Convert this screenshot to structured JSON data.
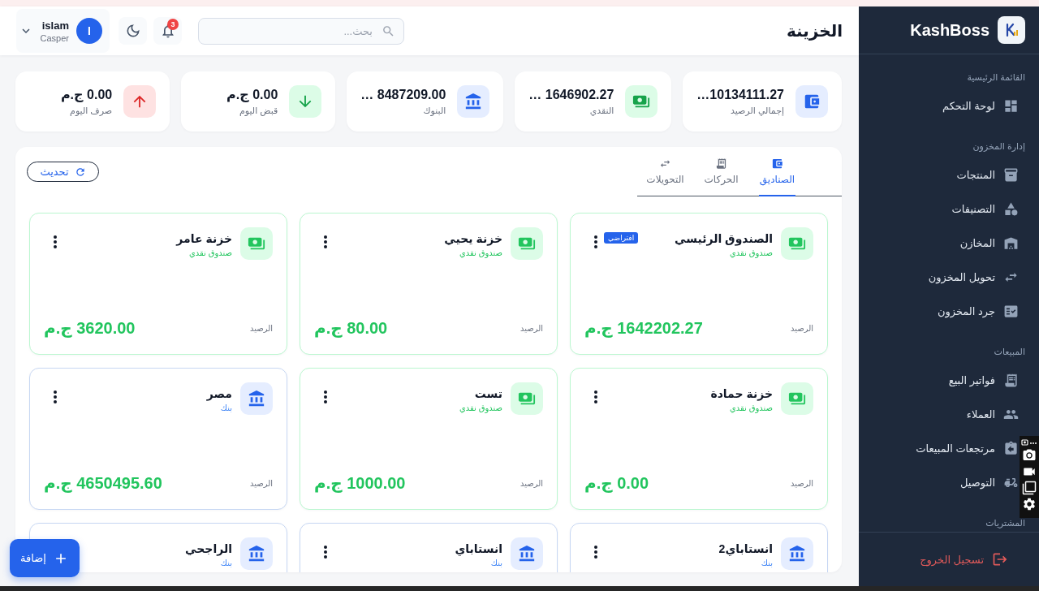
{
  "sidebar": {
    "brand": "KashBoss",
    "sections": [
      {
        "title": "القائمة الرئيسية",
        "items": [
          {
            "label": "لوحة التحكم",
            "selected": false
          }
        ]
      },
      {
        "title": "إدارة المخزون",
        "items": [
          {
            "label": "المنتجات",
            "selected": false
          },
          {
            "label": "التصنيفات",
            "selected": false
          },
          {
            "label": "المخازن",
            "selected": false
          },
          {
            "label": "تحويل المخزون",
            "selected": false
          },
          {
            "label": "جرد المخزون",
            "selected": false
          }
        ]
      },
      {
        "title": "المبيعات",
        "items": [
          {
            "label": "فواتير البيع",
            "selected": false
          },
          {
            "label": "العملاء",
            "selected": false
          },
          {
            "label": "مرتجعات المبيعات",
            "selected": false
          },
          {
            "label": "التوصيل",
            "selected": false
          }
        ]
      },
      {
        "title": "المشتريات"
      }
    ],
    "logout": "تسجيل الخروج"
  },
  "header": {
    "title": "الخزينة",
    "search": {
      "placeholder": "بحث..."
    },
    "notifications": "3",
    "user": {
      "initial": "I",
      "name": "islam",
      "role": "Casper"
    }
  },
  "stats": [
    {
      "kind": "total",
      "value": "10134111.27…",
      "label": "إجمالي الرصيد"
    },
    {
      "kind": "cash",
      "value": "1646902.27 …",
      "label": "النقدي"
    },
    {
      "kind": "bank",
      "value": "8487209.00 …",
      "label": "البنوك"
    },
    {
      "kind": "income",
      "value": "0.00 ج.م",
      "label": "قبض اليوم"
    },
    {
      "kind": "expense",
      "value": "0.00 ج.م",
      "label": "صرف اليوم"
    }
  ],
  "tabs": [
    {
      "label": "الصناديق",
      "selected": true
    },
    {
      "label": "الحركات",
      "selected": false
    },
    {
      "label": "التحويلات",
      "selected": false
    }
  ],
  "refresh_button": "تحديث",
  "accounts": [
    {
      "kind": "cash",
      "name": "الصندوق الرئيسي",
      "type": "صندوق نقدي",
      "badge": "افتراضي",
      "balance_label": "الرصيد",
      "balance": "1642202.27 ج.م"
    },
    {
      "kind": "cash",
      "name": "خزنة يحيي",
      "type": "صندوق نقدي",
      "balance_label": "الرصيد",
      "balance": "80.00 ج.م"
    },
    {
      "kind": "cash",
      "name": "خزنة عامر",
      "type": "صندوق نقدي",
      "balance_label": "الرصيد",
      "balance": "3620.00 ج.م"
    },
    {
      "kind": "cash",
      "name": "خزنة حمادة",
      "type": "صندوق نقدي",
      "balance_label": "الرصيد",
      "balance": "0.00 ج.م"
    },
    {
      "kind": "cash",
      "name": "تست",
      "type": "صندوق نقدي",
      "balance_label": "الرصيد",
      "balance": "1000.00 ج.م"
    },
    {
      "kind": "bank",
      "name": "مصر",
      "type": "بنك",
      "balance_label": "الرصيد",
      "balance": "4650495.60 ج.م"
    },
    {
      "kind": "bank",
      "name": "انستاباي2",
      "type": "بنك"
    },
    {
      "kind": "bank",
      "name": "انستاباي",
      "type": "بنك"
    },
    {
      "kind": "bank",
      "name": "الراجحي",
      "type": "بنك"
    }
  ],
  "add_button": "إضافة"
}
